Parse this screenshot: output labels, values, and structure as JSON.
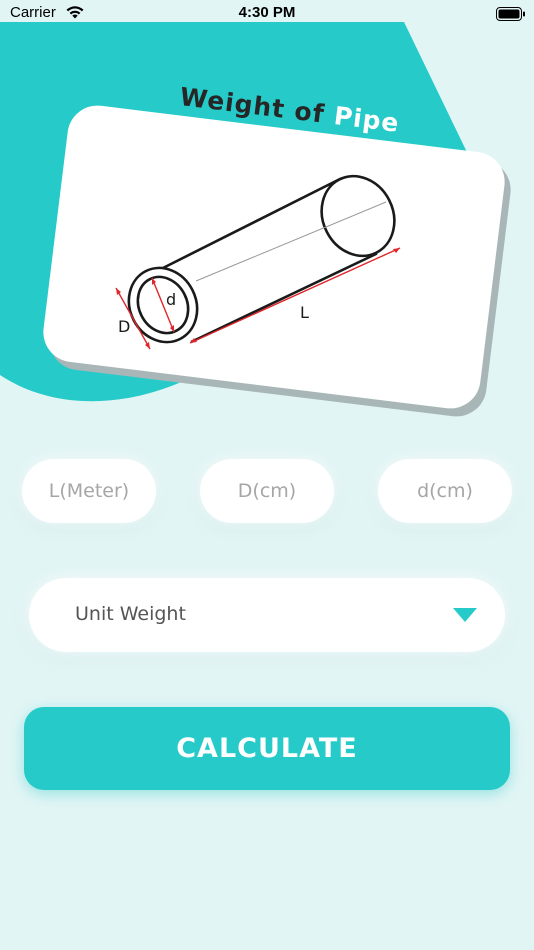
{
  "status_bar": {
    "carrier": "Carrier",
    "time": "4:30 PM",
    "wifi_icon": "wifi-icon",
    "battery_icon": "battery-icon"
  },
  "header": {
    "title_main": "Weight of ",
    "title_accent": "Pipe"
  },
  "diagram": {
    "outer_diameter_label": "D",
    "inner_diameter_label": "d",
    "length_label": "L"
  },
  "inputs": {
    "length_placeholder": "L(Meter)",
    "outer_diameter_placeholder": "D(cm)",
    "inner_diameter_placeholder": "d(cm)"
  },
  "unit_select": {
    "label": "Unit Weight",
    "icon": "caret-down-icon"
  },
  "actions": {
    "calculate_label": "CALCULATE"
  },
  "colors": {
    "accent": "#26cbc9",
    "background": "#e2f5f5",
    "dimension_lines": "#e0262b"
  }
}
